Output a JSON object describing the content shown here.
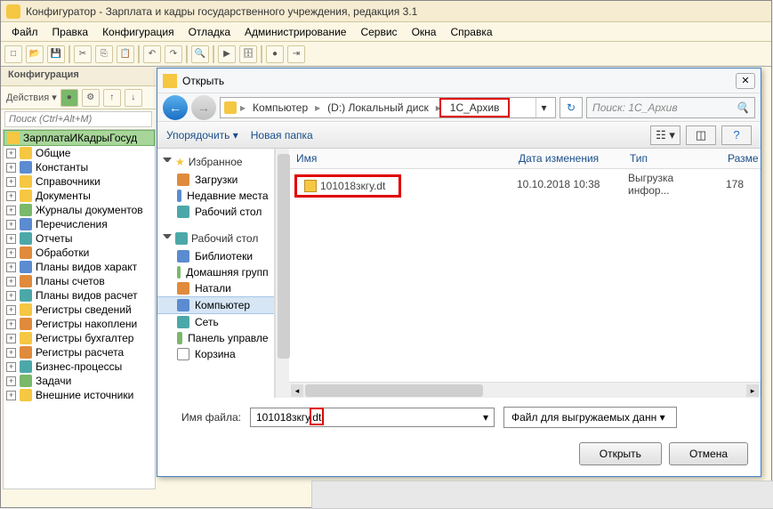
{
  "window": {
    "title": "Конфигуратор - Зарплата и кадры государственного учреждения, редакция 3.1"
  },
  "menubar": {
    "file": "Файл",
    "edit": "Правка",
    "config": "Конфигурация",
    "debug": "Отладка",
    "admin": "Администрирование",
    "service": "Сервис",
    "windows": "Окна",
    "help": "Справка"
  },
  "config_panel": {
    "header": "Конфигурация",
    "actions_label": "Действия ▾",
    "search_placeholder": "Поиск (Ctrl+Alt+M)"
  },
  "tree": [
    {
      "label": "ЗарплатаИКадрыГосуд",
      "icon": "ic-yellow",
      "selected": true
    },
    {
      "label": "Общие",
      "icon": "ic-yellow"
    },
    {
      "label": "Константы",
      "icon": "ic-blue"
    },
    {
      "label": "Справочники",
      "icon": "ic-yellow"
    },
    {
      "label": "Документы",
      "icon": "ic-yellow"
    },
    {
      "label": "Журналы документов",
      "icon": "ic-green"
    },
    {
      "label": "Перечисления",
      "icon": "ic-blue"
    },
    {
      "label": "Отчеты",
      "icon": "ic-teal"
    },
    {
      "label": "Обработки",
      "icon": "ic-orange"
    },
    {
      "label": "Планы видов характ",
      "icon": "ic-blue"
    },
    {
      "label": "Планы счетов",
      "icon": "ic-orange"
    },
    {
      "label": "Планы видов расчет",
      "icon": "ic-teal"
    },
    {
      "label": "Регистры сведений",
      "icon": "ic-yellow"
    },
    {
      "label": "Регистры накоплени",
      "icon": "ic-orange"
    },
    {
      "label": "Регистры бухгалтер",
      "icon": "ic-yellow"
    },
    {
      "label": "Регистры расчета",
      "icon": "ic-orange"
    },
    {
      "label": "Бизнес-процессы",
      "icon": "ic-teal"
    },
    {
      "label": "Задачи",
      "icon": "ic-green"
    },
    {
      "label": "Внешние источники",
      "icon": "ic-yellow"
    }
  ],
  "dialog": {
    "title": "Открыть",
    "breadcrumb": {
      "computer": "Компьютер",
      "disk": "(D:) Локальный диск",
      "folder": "1C_Архив"
    },
    "search_placeholder": "Поиск: 1C_Архив",
    "toolbar": {
      "organize": "Упорядочить ▾",
      "new_folder": "Новая папка"
    },
    "sidebar": {
      "favorites": "Избранное",
      "downloads": "Загрузки",
      "recent": "Недавние места",
      "desktop": "Рабочий стол",
      "desktop2": "Рабочий стол",
      "libraries": "Библиотеки",
      "homegroup": "Домашняя групп",
      "natali": "Натали",
      "computer": "Компьютер",
      "network": "Сеть",
      "control": "Панель управле",
      "recycle": "Корзина"
    },
    "columns": {
      "name": "Имя",
      "date": "Дата изменения",
      "type": "Тип",
      "size": "Разме"
    },
    "file": {
      "name": "101018зкгу.dt",
      "date": "10.10.2018 10:38",
      "type": "Выгрузка инфор...",
      "size": "178"
    },
    "filename_label": "Имя файла:",
    "filename_value": "101018зкгу.dt",
    "filetype": "Файл для выгружаемых данн ▾",
    "open_btn": "Открыть",
    "cancel_btn": "Отмена"
  }
}
